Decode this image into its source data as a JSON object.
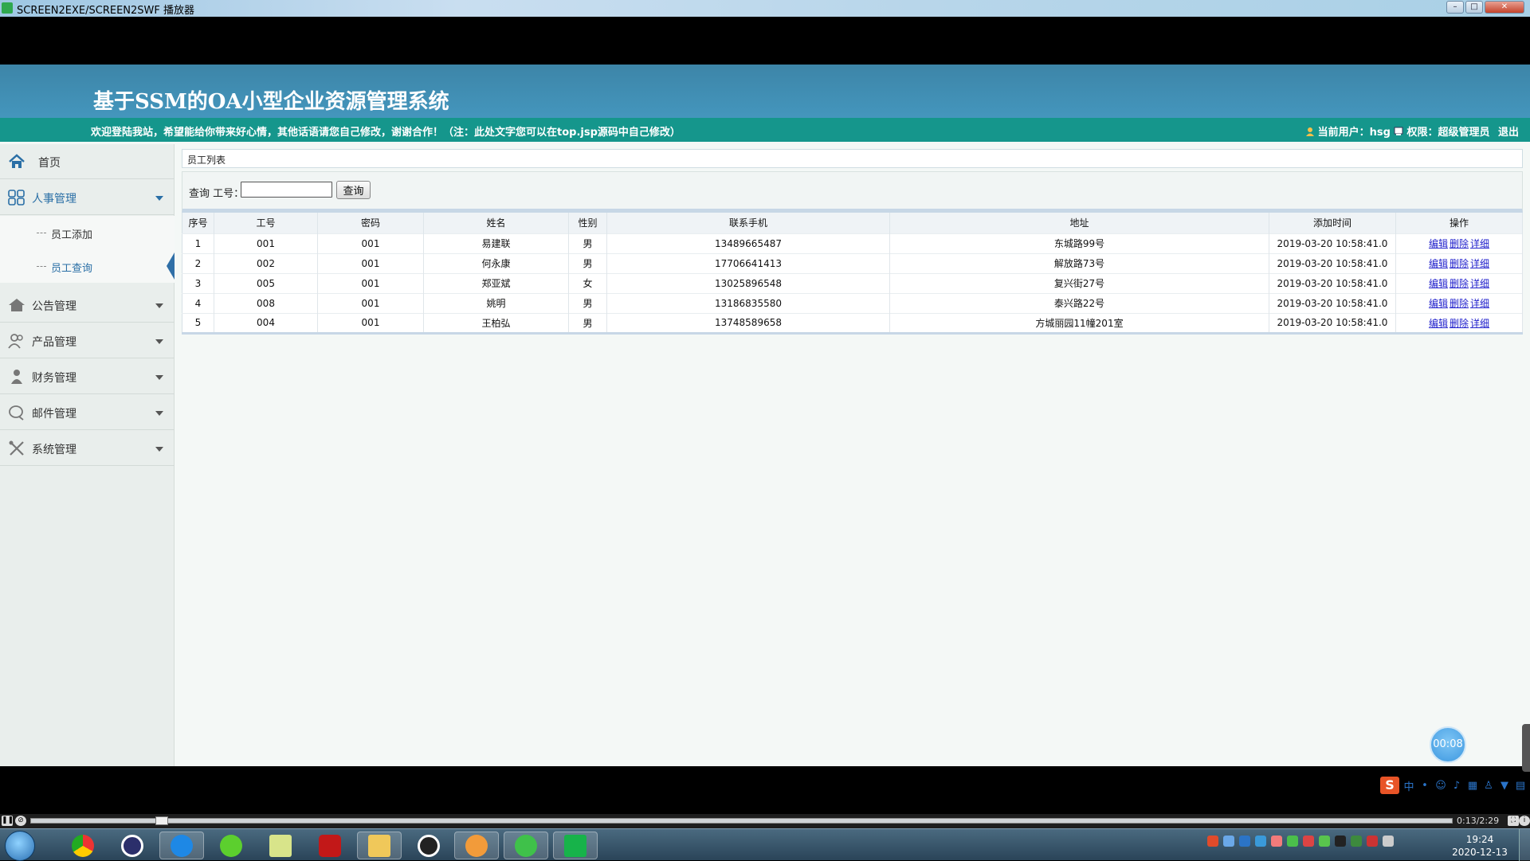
{
  "window": {
    "title": "SCREEN2EXE/SCREEN2SWF 播放器"
  },
  "app": {
    "title": "基于SSM的OA小型企业资源管理系统",
    "welcome": "欢迎登陆我站，希望能给你带来好心情，其他话语请您自己修改，谢谢合作！（注：此处文字您可以在top.jsp源码中自己修改）",
    "current_user": "当前用户：hsg",
    "permission": "权限：超级管理员",
    "logout": "退出"
  },
  "sidebar": {
    "home": "首页",
    "items": [
      {
        "label": "人事管理",
        "icon": "grid-icon"
      },
      {
        "label": "公告管理",
        "icon": "house-icon"
      },
      {
        "label": "产品管理",
        "icon": "people-icon"
      },
      {
        "label": "财务管理",
        "icon": "person-icon"
      },
      {
        "label": "邮件管理",
        "icon": "chat-icon"
      },
      {
        "label": "系统管理",
        "icon": "tools-icon"
      }
    ],
    "sub_items": [
      "员工添加",
      "员工查询"
    ]
  },
  "main": {
    "breadcrumb": "员工列表",
    "search_label": "查询 工号：",
    "search_value": "",
    "search_button": "查询",
    "columns": [
      "序号",
      "工号",
      "密码",
      "姓名",
      "性别",
      "联系手机",
      "地址",
      "添加时间",
      "操作"
    ],
    "rows": [
      [
        "1",
        "001",
        "001",
        "易建联",
        "男",
        "13489665487",
        "东城路99号",
        "2019-03-20 10:58:41.0"
      ],
      [
        "2",
        "002",
        "001",
        "何永康",
        "男",
        "17706641413",
        "解放路73号",
        "2019-03-20 10:58:41.0"
      ],
      [
        "3",
        "005",
        "001",
        "郑亚斌",
        "女",
        "13025896548",
        "复兴街27号",
        "2019-03-20 10:58:41.0"
      ],
      [
        "4",
        "008",
        "001",
        "姚明",
        "男",
        "13186835580",
        "泰兴路22号",
        "2019-03-20 10:58:41.0"
      ],
      [
        "5",
        "004",
        "001",
        "王柏弘",
        "男",
        "13748589658",
        "方城丽园11幢201室",
        "2019-03-20 10:58:41.0"
      ]
    ],
    "actions": [
      "编辑",
      "删除",
      "详细"
    ]
  },
  "overlay": {
    "timer": "00:08"
  },
  "ime": {
    "logo": "S",
    "lang": "中"
  },
  "player": {
    "time": "0:13/2:29"
  },
  "taskbar": {
    "time": "19:24",
    "date": "2020-12-13"
  },
  "colors": {
    "banner": "#4091b8",
    "welcome_bar": "#15968c",
    "link": "#2222cc",
    "active_nav": "#2a6fa6"
  }
}
